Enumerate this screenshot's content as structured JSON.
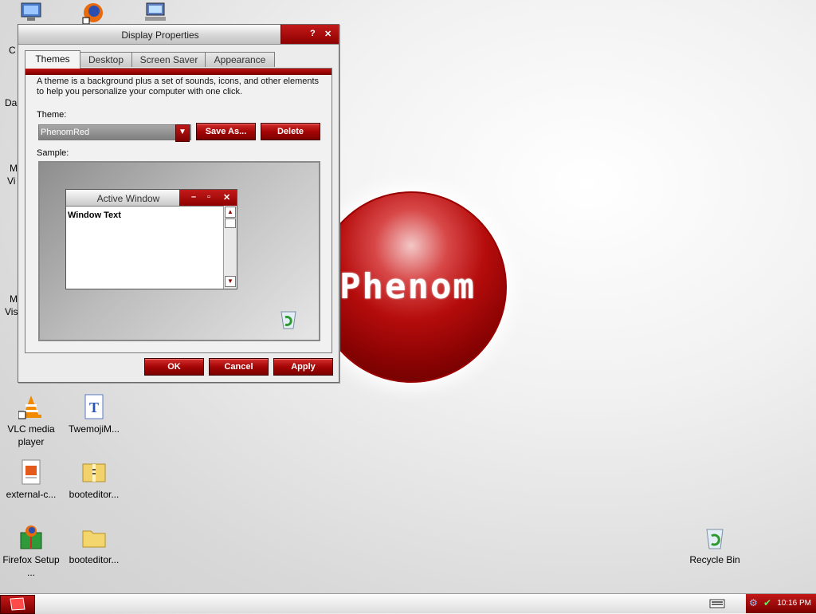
{
  "window": {
    "title": "Display Properties",
    "help_label": "?",
    "close_label": "✕",
    "tabs": [
      {
        "label": "Themes"
      },
      {
        "label": "Desktop"
      },
      {
        "label": "Screen Saver"
      },
      {
        "label": "Appearance"
      }
    ],
    "description": "A theme is a background plus a set of sounds, icons, and other elements to help you personalize your computer with one click.",
    "theme_label": "Theme:",
    "theme_value": "PhenomRed",
    "save_as_label": "Save As...",
    "delete_label": "Delete",
    "sample_label": "Sample:",
    "sample_window_title": "Active Window",
    "sample_window_text": "Window Text",
    "ok_label": "OK",
    "cancel_label": "Cancel",
    "apply_label": "Apply"
  },
  "wallpaper": {
    "logo_text": "Phenom"
  },
  "desktop_icons": [
    {
      "label": "VLC media player",
      "icon": "vlc-icon"
    },
    {
      "label": "TwemojiM...",
      "icon": "font-file-icon"
    },
    {
      "label": "external-c...",
      "icon": "document-icon"
    },
    {
      "label": "booteditor...",
      "icon": "zip-folder-icon"
    },
    {
      "label": "Firefox Setup ...",
      "icon": "installer-icon"
    },
    {
      "label": "booteditor...",
      "icon": "folder-icon"
    },
    {
      "label": "Recycle Bin",
      "icon": "recycle-bin-icon"
    }
  ],
  "partial_labels": [
    "C",
    "Da",
    "M",
    "Vi",
    "M",
    "Vis"
  ],
  "taskbar": {
    "clock": "10:16 PM"
  },
  "colors": {
    "accent": "#a50505",
    "accent_dark": "#7a0000"
  }
}
